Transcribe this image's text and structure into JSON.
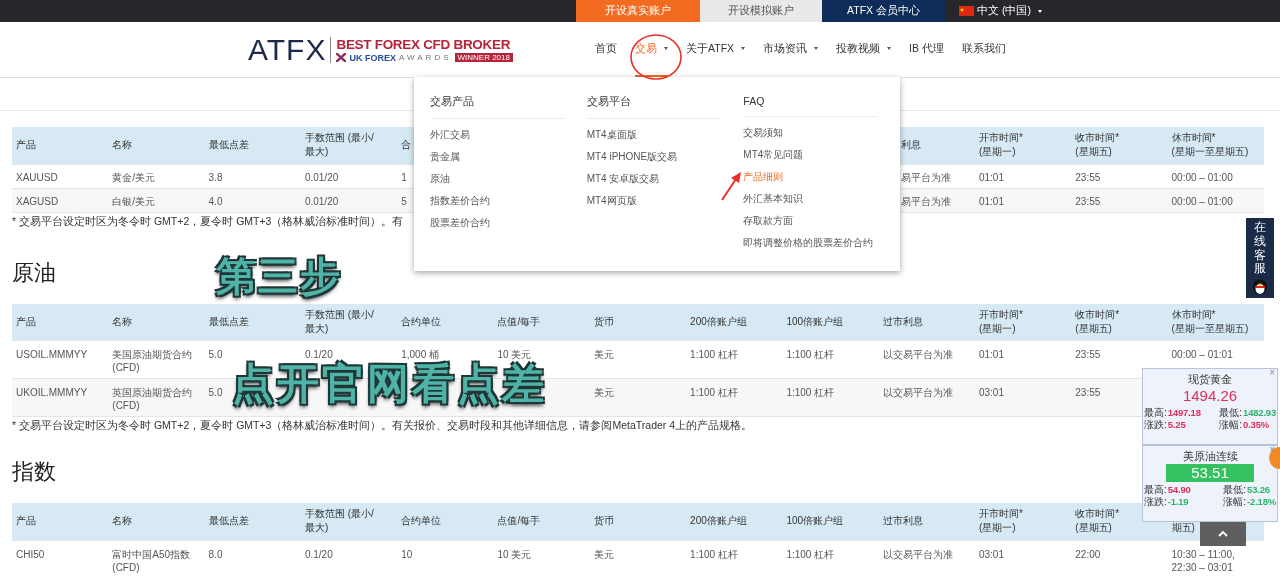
{
  "top_bar": {
    "links": [
      {
        "label": "开设真实账户",
        "kind": "real"
      },
      {
        "label": "开设模拟账户",
        "kind": "demo"
      },
      {
        "label": "ATFX 会员中心",
        "kind": "member"
      }
    ],
    "language": {
      "label": "中文 (中国)"
    }
  },
  "header": {
    "logo": {
      "brand": "ATFX",
      "award_title": "BEST FOREX CFD BROKER",
      "award_org": "UK FOREX",
      "award_word": "AWARDS",
      "badge": "WINNER 2018"
    },
    "nav": [
      {
        "label": "首页",
        "dropdown": false,
        "selected": false
      },
      {
        "label": "交易",
        "dropdown": true,
        "selected": true
      },
      {
        "label": "关于ATFX",
        "dropdown": true,
        "selected": false
      },
      {
        "label": "市场资讯",
        "dropdown": true,
        "selected": false
      },
      {
        "label": "投教视频",
        "dropdown": true,
        "selected": false
      },
      {
        "label": "IB 代理",
        "dropdown": false,
        "selected": false
      },
      {
        "label": "联系我们",
        "dropdown": false,
        "selected": false
      }
    ]
  },
  "sections": [
    {
      "table": {
        "columns": [
          "产品",
          "名称",
          "最低点差",
          "手数范围 (最小/最大)",
          "合",
          null,
          null,
          null,
          null,
          "利息",
          "开市时间* (星期一)",
          "收市时间* (星期五)",
          "休市时间* (星期一至星期五)"
        ],
        "rows": [
          [
            "XAUUSD",
            "黄金/美元",
            "3.8",
            "0.01/20",
            "1",
            null,
            null,
            null,
            null,
            "易平台为准",
            "01:01",
            "23:55",
            "00:00 – 01:00"
          ],
          [
            "XAGUSD",
            "白银/美元",
            "4.0",
            "0.01/20",
            "5",
            null,
            null,
            null,
            null,
            "易平台为准",
            "01:01",
            "23:55",
            "00:00 – 01:00"
          ]
        ]
      },
      "note": "* 交易平台设定时区为冬令时 GMT+2，夏令时 GMT+3（格林威治标准时间）。有"
    },
    {
      "heading": "原油",
      "table": {
        "columns": [
          "产品",
          "名称",
          "最低点差",
          "手数范围 (最小/最大)",
          "合约单位",
          "点值/每手",
          "货币",
          "200倍账户组",
          "100倍账户组",
          "过市利息",
          "开市时间* (星期一)",
          "收市时间* (星期五)",
          "休市时间* (星期一至星期五)"
        ],
        "rows": [
          [
            "USOIL.MMMYY",
            "美国原油期货合约(CFD)",
            "5.0",
            "0.1/20",
            "1,000 桶",
            "10 美元",
            "美元",
            "1:100 杠杆",
            "1:100 杠杆",
            "以交易平台为准",
            "01:01",
            "23:55",
            "00:00 – 01:01"
          ],
          [
            "UKOIL.MMMYY",
            "英国原油期货合约(CFD)",
            "5.0",
            null,
            null,
            null,
            "美元",
            "1:100 杠杆",
            "1:100 杠杆",
            "以交易平台为准",
            "03:01",
            "23:55",
            null
          ]
        ]
      },
      "note": "* 交易平台设定时区为冬令时 GMT+2，夏令时 GMT+3（格林威治标准时间）。有关报价、交易时段和其他详细信息，请参阅MetaTrader 4上的产品规格。"
    },
    {
      "heading": "指数",
      "table": {
        "columns": [
          "产品",
          "名称",
          "最低点差",
          "手数范围 (最小/最大)",
          "合约单位",
          "点值/每手",
          "货币",
          "200倍账户组",
          "100倍账户组",
          "过市利息",
          "开市时间* (星期一)",
          "收市时间* (星期五)",
          "期五)"
        ],
        "rows": [
          [
            "CHI50",
            "富时中国A50指数(CFD)",
            "8.0",
            "0.1/20",
            "10",
            "10 美元",
            "美元",
            "1:100 杠杆",
            "1:100 杠杆",
            "以交易平台为准",
            "03:01",
            "22:00",
            "10:30 – 11:00, 22:30 – 03:01"
          ]
        ]
      }
    }
  ],
  "dropdown": {
    "columns": [
      {
        "heading": "交易产品",
        "items": [
          {
            "label": "外汇交易",
            "highlighted": false
          },
          {
            "label": "贵金属",
            "highlighted": false
          },
          {
            "label": "原油",
            "highlighted": false
          },
          {
            "label": "指数差价合约",
            "highlighted": false
          },
          {
            "label": "股票差价合约",
            "highlighted": false
          }
        ]
      },
      {
        "heading": "交易平台",
        "items": [
          {
            "label": "MT4桌面版",
            "highlighted": false
          },
          {
            "label": "MT4 iPHONE版交易",
            "highlighted": false
          },
          {
            "label": "MT4 安卓版交易",
            "highlighted": false
          },
          {
            "label": "MT4网页版",
            "highlighted": false
          }
        ]
      },
      {
        "heading": "FAQ",
        "items": [
          {
            "label": "交易须知",
            "highlighted": false
          },
          {
            "label": "MT4常见问题",
            "highlighted": false
          },
          {
            "label": "产品细则",
            "highlighted": true
          },
          {
            "label": "外汇基本知识",
            "highlighted": false
          },
          {
            "label": "存取款方面",
            "highlighted": false
          },
          {
            "label": "即将调整价格的股票差价合约",
            "highlighted": false
          }
        ]
      }
    ]
  },
  "captions": [
    "第三步",
    "点开官网看点差"
  ],
  "service_tab": {
    "label": "在线客服"
  },
  "quotes": [
    {
      "title": "现货黄金",
      "price": "1494.26",
      "boxed": false,
      "color": "#e0305a",
      "close": "×",
      "stats": [
        {
          "label": "最高:",
          "value": "1497.18",
          "color": "#e0305a"
        },
        {
          "label": "最低:",
          "value": "1482.93",
          "color": "#2eb36a"
        },
        {
          "label": "涨跌:",
          "value": "5.25",
          "color": "#e0305a"
        },
        {
          "label": "涨幅:",
          "value": "0.35%",
          "color": "#e0305a"
        }
      ]
    },
    {
      "title": "美原油连续",
      "price": "53.51",
      "boxed": true,
      "color": "#35c160",
      "close": "×",
      "stats": [
        {
          "label": "最高:",
          "value": "54.90",
          "color": "#e0305a"
        },
        {
          "label": "最低:",
          "value": "53.26",
          "color": "#2eb36a"
        },
        {
          "label": "涨跌:",
          "value": "-1.19",
          "color": "#2eb36a"
        },
        {
          "label": "涨幅:",
          "value": "-2.18%",
          "color": "#2eb36a"
        }
      ]
    }
  ]
}
